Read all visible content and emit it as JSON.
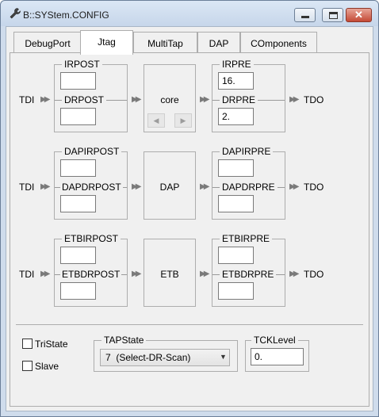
{
  "window": {
    "title": "B::SYStem.CONFIG"
  },
  "tabs": [
    "DebugPort",
    "Jtag",
    "MultiTap",
    "DAP",
    "COmponents"
  ],
  "active_tab": "Jtag",
  "rows": [
    {
      "tdi": "TDI",
      "tdo": "TDO",
      "pre_group": {
        "label": "IRPOST",
        "ir_value": "",
        "dr_label": "DRPOST",
        "dr_value": ""
      },
      "center_label": "core",
      "post_group": {
        "label": "IRPRE",
        "ir_value": "16.",
        "dr_label": "DRPRE",
        "dr_value": "2."
      }
    },
    {
      "tdi": "TDI",
      "tdo": "TDO",
      "pre_group": {
        "label": "DAPIRPOST",
        "ir_value": "",
        "dr_label": "DAPDRPOST",
        "dr_value": ""
      },
      "center_label": "DAP",
      "post_group": {
        "label": "DAPIRPRE",
        "ir_value": "",
        "dr_label": "DAPDRPRE",
        "dr_value": ""
      }
    },
    {
      "tdi": "TDI",
      "tdo": "TDO",
      "pre_group": {
        "label": "ETBIRPOST",
        "ir_value": "",
        "dr_label": "ETBDRPOST",
        "dr_value": ""
      },
      "center_label": "ETB",
      "post_group": {
        "label": "ETBIRPRE",
        "ir_value": "",
        "dr_label": "ETBDRPRE",
        "dr_value": ""
      }
    }
  ],
  "options": {
    "tristate": {
      "label": "TriState",
      "checked": false
    },
    "slave": {
      "label": "Slave",
      "checked": false
    },
    "tapstate": {
      "label": "TAPState",
      "value": "7  (Select-DR-Scan)"
    },
    "tcklevel": {
      "label": "TCKLevel",
      "value": "0."
    }
  },
  "icons": {
    "app": "wrench-icon",
    "minimize": "minimize-icon",
    "maximize": "maximize-icon",
    "close": "close-icon",
    "arrow": "double-chevron-right-icon",
    "scroll_left": "triangle-left-icon",
    "scroll_right": "triangle-right-icon",
    "dropdown": "chevron-down-icon"
  }
}
